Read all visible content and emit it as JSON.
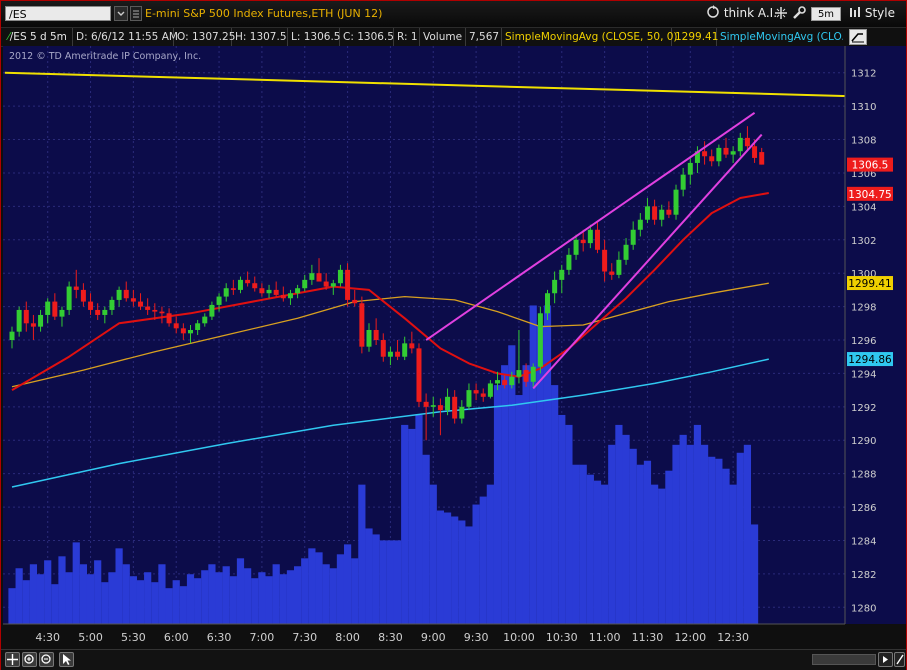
{
  "toolbar": {
    "symbol": "/ES",
    "description": "E-mini S&P 500 Index Futures,ETH (JUN 12)",
    "think_label": "think A.I.",
    "period_label": "5m",
    "style_label": "Style"
  },
  "infobar": {
    "study_label": "/ES 5 d 5m",
    "date": "D: 6/6/12 11:55 AM",
    "open": "O: 1307.25",
    "high": "H: 1307.5",
    "low": "L: 1306.5",
    "close": "C: 1306.5",
    "range": "R: 1",
    "volume_label": "Volume",
    "volume_value": "7,567",
    "sma1_label": "SimpleMovingAvg (CLOSE, 50, 0)",
    "sma1_value": "1299.41",
    "sma2_label": "SimpleMovingAvg (CLO..."
  },
  "copyright": "2012 © TD Ameritrade IP Company, Inc.",
  "colors": {
    "background": "#0c0c4a",
    "grid": "#2a2a7a",
    "up": "#33cc33",
    "down": "#ee1c1c",
    "doji": "#ffffff",
    "volume": "#2a3bd6",
    "sma_red": "#e01010",
    "sma_orange": "#d8a020",
    "sma_cyan": "#30c8f0",
    "trendline_yellow": "#f0e000",
    "trendline_magenta": "#e040e0"
  },
  "chart_data": {
    "type": "candlestick",
    "x_labels": [
      "4:30",
      "5:00",
      "5:30",
      "6:00",
      "6:30",
      "7:00",
      "7:30",
      "8:00",
      "8:30",
      "9:00",
      "9:30",
      "10:00",
      "10:30",
      "11:00",
      "11:30",
      "12:00",
      "12:30"
    ],
    "y_ticks": [
      1280,
      1282,
      1284,
      1286,
      1288,
      1290,
      1292,
      1294,
      1296,
      1298,
      1300,
      1302,
      1304,
      1306,
      1308,
      1310,
      1312
    ],
    "ylim": [
      1279,
      1313.6
    ],
    "price_labels": [
      {
        "value": 1306.5,
        "label": "1306.5",
        "color": "#ee1c1c",
        "text_color": "#ffffff"
      },
      {
        "value": 1304.75,
        "label": "1304.75",
        "color": "#ee1c1c",
        "text_color": "#ffffff"
      },
      {
        "value": 1299.41,
        "label": "1299.41",
        "color": "#f0d000",
        "text_color": "#000000"
      },
      {
        "value": 1294.86,
        "label": "1294.86",
        "color": "#30c8f0",
        "text_color": "#000000"
      }
    ],
    "candles": {
      "start_time": "4:05",
      "interval_minutes": 5,
      "ohlc": [
        [
          1296.0,
          1296.8,
          1295.5,
          1296.5
        ],
        [
          1296.5,
          1298.0,
          1296.2,
          1297.8
        ],
        [
          1297.8,
          1298.3,
          1296.5,
          1297.0
        ],
        [
          1297.0,
          1297.5,
          1296.0,
          1296.8
        ],
        [
          1296.8,
          1297.8,
          1296.5,
          1297.5
        ],
        [
          1297.5,
          1298.5,
          1297.0,
          1298.3
        ],
        [
          1298.3,
          1298.8,
          1297.2,
          1297.4
        ],
        [
          1297.4,
          1298.0,
          1296.8,
          1297.8
        ],
        [
          1297.8,
          1299.5,
          1297.5,
          1299.2
        ],
        [
          1299.2,
          1300.2,
          1298.5,
          1299.0
        ],
        [
          1299.0,
          1299.4,
          1298.0,
          1298.3
        ],
        [
          1298.3,
          1298.8,
          1297.5,
          1297.8
        ],
        [
          1297.8,
          1298.2,
          1297.2,
          1297.5
        ],
        [
          1297.5,
          1298.0,
          1297.0,
          1297.8
        ],
        [
          1297.8,
          1298.6,
          1297.5,
          1298.4
        ],
        [
          1298.4,
          1299.2,
          1298.0,
          1299.0
        ],
        [
          1299.0,
          1299.5,
          1298.3,
          1298.5
        ],
        [
          1298.5,
          1299.0,
          1298.0,
          1298.3
        ],
        [
          1298.3,
          1298.8,
          1297.8,
          1298.0
        ],
        [
          1298.0,
          1298.5,
          1297.5,
          1297.8
        ],
        [
          1297.8,
          1298.2,
          1297.2,
          1297.7
        ],
        [
          1297.7,
          1298.0,
          1297.0,
          1297.6
        ],
        [
          1297.6,
          1297.9,
          1296.8,
          1297.0
        ],
        [
          1297.0,
          1297.4,
          1296.4,
          1296.7
        ],
        [
          1296.7,
          1297.0,
          1296.0,
          1296.4
        ],
        [
          1296.4,
          1296.9,
          1295.8,
          1296.6
        ],
        [
          1296.6,
          1297.2,
          1296.3,
          1297.0
        ],
        [
          1297.0,
          1297.6,
          1296.8,
          1297.4
        ],
        [
          1297.4,
          1298.3,
          1297.2,
          1298.1
        ],
        [
          1298.1,
          1298.8,
          1297.7,
          1298.6
        ],
        [
          1298.6,
          1299.4,
          1298.3,
          1299.1
        ],
        [
          1299.1,
          1299.6,
          1298.7,
          1299.0
        ],
        [
          1299.0,
          1299.8,
          1298.8,
          1299.6
        ],
        [
          1299.6,
          1300.1,
          1299.2,
          1299.4
        ],
        [
          1299.4,
          1299.8,
          1298.9,
          1299.1
        ],
        [
          1299.1,
          1299.4,
          1298.6,
          1298.8
        ],
        [
          1298.8,
          1299.3,
          1298.5,
          1299.0
        ],
        [
          1299.0,
          1299.5,
          1298.6,
          1298.7
        ],
        [
          1298.7,
          1299.2,
          1298.3,
          1298.5
        ],
        [
          1298.5,
          1299.0,
          1298.1,
          1298.8
        ],
        [
          1298.8,
          1299.3,
          1298.5,
          1299.1
        ],
        [
          1299.1,
          1299.9,
          1298.9,
          1299.6
        ],
        [
          1299.6,
          1300.5,
          1299.3,
          1300.0
        ],
        [
          1300.0,
          1300.9,
          1299.6,
          1299.5
        ],
        [
          1299.5,
          1300.0,
          1299.0,
          1299.2
        ],
        [
          1299.2,
          1299.6,
          1298.7,
          1299.4
        ],
        [
          1299.4,
          1300.5,
          1299.2,
          1300.2
        ],
        [
          1300.2,
          1300.6,
          1298.0,
          1298.4
        ],
        [
          1298.4,
          1299.0,
          1298.0,
          1298.2
        ],
        [
          1298.2,
          1298.6,
          1295.2,
          1295.6
        ],
        [
          1295.6,
          1297.0,
          1295.3,
          1296.6
        ],
        [
          1296.6,
          1297.3,
          1295.7,
          1296.0
        ],
        [
          1296.0,
          1296.4,
          1294.7,
          1295.0
        ],
        [
          1295.0,
          1295.6,
          1294.5,
          1295.3
        ],
        [
          1295.3,
          1296.0,
          1294.8,
          1295.0
        ],
        [
          1295.0,
          1296.2,
          1294.8,
          1295.8
        ],
        [
          1295.8,
          1296.5,
          1295.2,
          1295.5
        ],
        [
          1295.5,
          1295.8,
          1292.0,
          1292.3
        ],
        [
          1292.3,
          1292.8,
          1290.0,
          1292.0
        ],
        [
          1292.0,
          1292.6,
          1291.4,
          1292.1
        ],
        [
          1292.1,
          1292.5,
          1290.3,
          1291.8
        ],
        [
          1291.8,
          1293.1,
          1291.5,
          1292.6
        ],
        [
          1292.6,
          1293.0,
          1291.0,
          1291.3
        ],
        [
          1291.3,
          1292.4,
          1291.0,
          1292.0
        ],
        [
          1292.0,
          1293.4,
          1291.8,
          1293.0
        ],
        [
          1293.0,
          1293.4,
          1292.4,
          1292.8
        ],
        [
          1292.8,
          1293.1,
          1292.3,
          1292.6
        ],
        [
          1292.6,
          1293.6,
          1292.5,
          1293.4
        ],
        [
          1293.4,
          1294.1,
          1293.0,
          1293.6
        ],
        [
          1293.6,
          1293.9,
          1293.1,
          1293.3
        ],
        [
          1293.3,
          1294.1,
          1293.1,
          1293.8
        ],
        [
          1293.8,
          1296.6,
          1293.4,
          1294.2
        ],
        [
          1294.2,
          1294.6,
          1293.2,
          1293.5
        ],
        [
          1293.5,
          1294.6,
          1293.2,
          1294.4
        ],
        [
          1294.4,
          1298.0,
          1294.0,
          1297.6
        ],
        [
          1297.6,
          1299.0,
          1297.2,
          1298.8
        ],
        [
          1298.8,
          1300.1,
          1298.2,
          1299.6
        ],
        [
          1299.6,
          1300.5,
          1298.8,
          1300.2
        ],
        [
          1300.2,
          1301.5,
          1299.9,
          1301.1
        ],
        [
          1301.1,
          1302.3,
          1300.8,
          1302.0
        ],
        [
          1302.0,
          1302.6,
          1301.3,
          1301.8
        ],
        [
          1301.8,
          1302.9,
          1301.5,
          1302.6
        ],
        [
          1302.6,
          1303.1,
          1301.2,
          1301.4
        ],
        [
          1301.4,
          1302.0,
          1299.5,
          1300.1
        ],
        [
          1300.1,
          1300.6,
          1299.6,
          1299.9
        ],
        [
          1299.9,
          1301.3,
          1299.7,
          1300.8
        ],
        [
          1300.8,
          1302.1,
          1300.5,
          1301.7
        ],
        [
          1301.7,
          1303.1,
          1301.4,
          1302.6
        ],
        [
          1302.6,
          1303.6,
          1302.2,
          1303.2
        ],
        [
          1303.2,
          1304.5,
          1303.0,
          1304.0
        ],
        [
          1304.0,
          1304.4,
          1302.9,
          1303.2
        ],
        [
          1303.2,
          1304.1,
          1302.8,
          1303.8
        ],
        [
          1303.8,
          1304.3,
          1303.3,
          1303.5
        ],
        [
          1303.5,
          1305.3,
          1303.2,
          1305.0
        ],
        [
          1305.0,
          1306.3,
          1304.6,
          1305.9
        ],
        [
          1305.9,
          1306.9,
          1305.3,
          1306.6
        ],
        [
          1306.6,
          1307.6,
          1306.0,
          1307.3
        ],
        [
          1307.3,
          1307.9,
          1306.5,
          1307.0
        ],
        [
          1307.0,
          1307.4,
          1306.4,
          1306.7
        ],
        [
          1306.7,
          1307.7,
          1306.4,
          1307.5
        ],
        [
          1307.5,
          1308.1,
          1306.9,
          1307.1
        ],
        [
          1307.1,
          1307.6,
          1306.6,
          1307.3
        ],
        [
          1307.3,
          1308.4,
          1307.0,
          1308.1
        ],
        [
          1308.1,
          1308.8,
          1307.3,
          1307.6
        ],
        [
          1307.6,
          1308.0,
          1306.6,
          1306.9
        ],
        [
          1307.25,
          1307.5,
          1306.5,
          1306.5
        ]
      ]
    },
    "volume": [
      180,
      280,
      220,
      300,
      250,
      320,
      200,
      340,
      260,
      410,
      300,
      250,
      320,
      210,
      260,
      380,
      300,
      240,
      220,
      260,
      210,
      300,
      180,
      220,
      190,
      250,
      230,
      270,
      300,
      260,
      290,
      240,
      330,
      280,
      230,
      260,
      240,
      300,
      250,
      270,
      290,
      330,
      380,
      360,
      300,
      280,
      350,
      400,
      330,
      700,
      480,
      450,
      420,
      420,
      420,
      1000,
      980,
      1050,
      850,
      700,
      570,
      560,
      540,
      520,
      490,
      600,
      640,
      700,
      1200,
      1300,
      1400,
      1150,
      1300,
      1600,
      1500,
      1600,
      1200,
      1050,
      1000,
      800,
      800,
      750,
      720,
      700,
      900,
      1000,
      950,
      880,
      800,
      820,
      700,
      680,
      770,
      900,
      950,
      900,
      1000,
      900,
      840,
      830,
      780,
      700,
      860,
      900,
      500
    ],
    "volume_max": 1800,
    "sma_red": [
      [
        0,
        1293.0
      ],
      [
        8,
        1295.0
      ],
      [
        15,
        1297.0
      ],
      [
        25,
        1297.6
      ],
      [
        35,
        1298.4
      ],
      [
        45,
        1299.2
      ],
      [
        50,
        1299.0
      ],
      [
        55,
        1297.3
      ],
      [
        60,
        1295.5
      ],
      [
        64,
        1294.6
      ],
      [
        68,
        1294.0
      ],
      [
        71,
        1293.8
      ],
      [
        74,
        1294.3
      ],
      [
        78,
        1295.5
      ],
      [
        82,
        1297.0
      ],
      [
        86,
        1298.5
      ],
      [
        90,
        1300.2
      ],
      [
        94,
        1302.0
      ],
      [
        98,
        1303.6
      ],
      [
        102,
        1304.5
      ],
      [
        106,
        1304.8
      ]
    ],
    "sma_orange": [
      [
        0,
        1293.2
      ],
      [
        10,
        1294.2
      ],
      [
        20,
        1295.3
      ],
      [
        30,
        1296.3
      ],
      [
        40,
        1297.3
      ],
      [
        48,
        1298.3
      ],
      [
        55,
        1298.6
      ],
      [
        62,
        1298.4
      ],
      [
        68,
        1297.7
      ],
      [
        74,
        1296.8
      ],
      [
        80,
        1296.9
      ],
      [
        86,
        1297.6
      ],
      [
        92,
        1298.3
      ],
      [
        98,
        1298.8
      ],
      [
        106,
        1299.4
      ]
    ],
    "sma_cyan": [
      [
        0,
        1287.2
      ],
      [
        15,
        1288.6
      ],
      [
        30,
        1289.8
      ],
      [
        45,
        1290.9
      ],
      [
        60,
        1291.7
      ],
      [
        70,
        1292.1
      ],
      [
        80,
        1292.7
      ],
      [
        90,
        1293.4
      ],
      [
        98,
        1294.1
      ],
      [
        106,
        1294.86
      ]
    ],
    "trendlines": [
      {
        "color": "yellow",
        "points": [
          [
            -1,
            1312.0
          ],
          [
            117,
            1310.6
          ]
        ]
      },
      {
        "color": "magenta",
        "points": [
          [
            58,
            1296.0
          ],
          [
            104,
            1309.6
          ]
        ]
      },
      {
        "color": "magenta",
        "points": [
          [
            73,
            1293.1
          ],
          [
            105,
            1308.3
          ]
        ]
      }
    ]
  },
  "bottom_icons": [
    "crosshair-icon",
    "zoom-in-icon",
    "zoom-out-icon",
    "pointer-icon"
  ],
  "bottom_right_icons": [
    "scroll-left-icon",
    "scroll-right-icon",
    "drawing-tool-icon"
  ]
}
